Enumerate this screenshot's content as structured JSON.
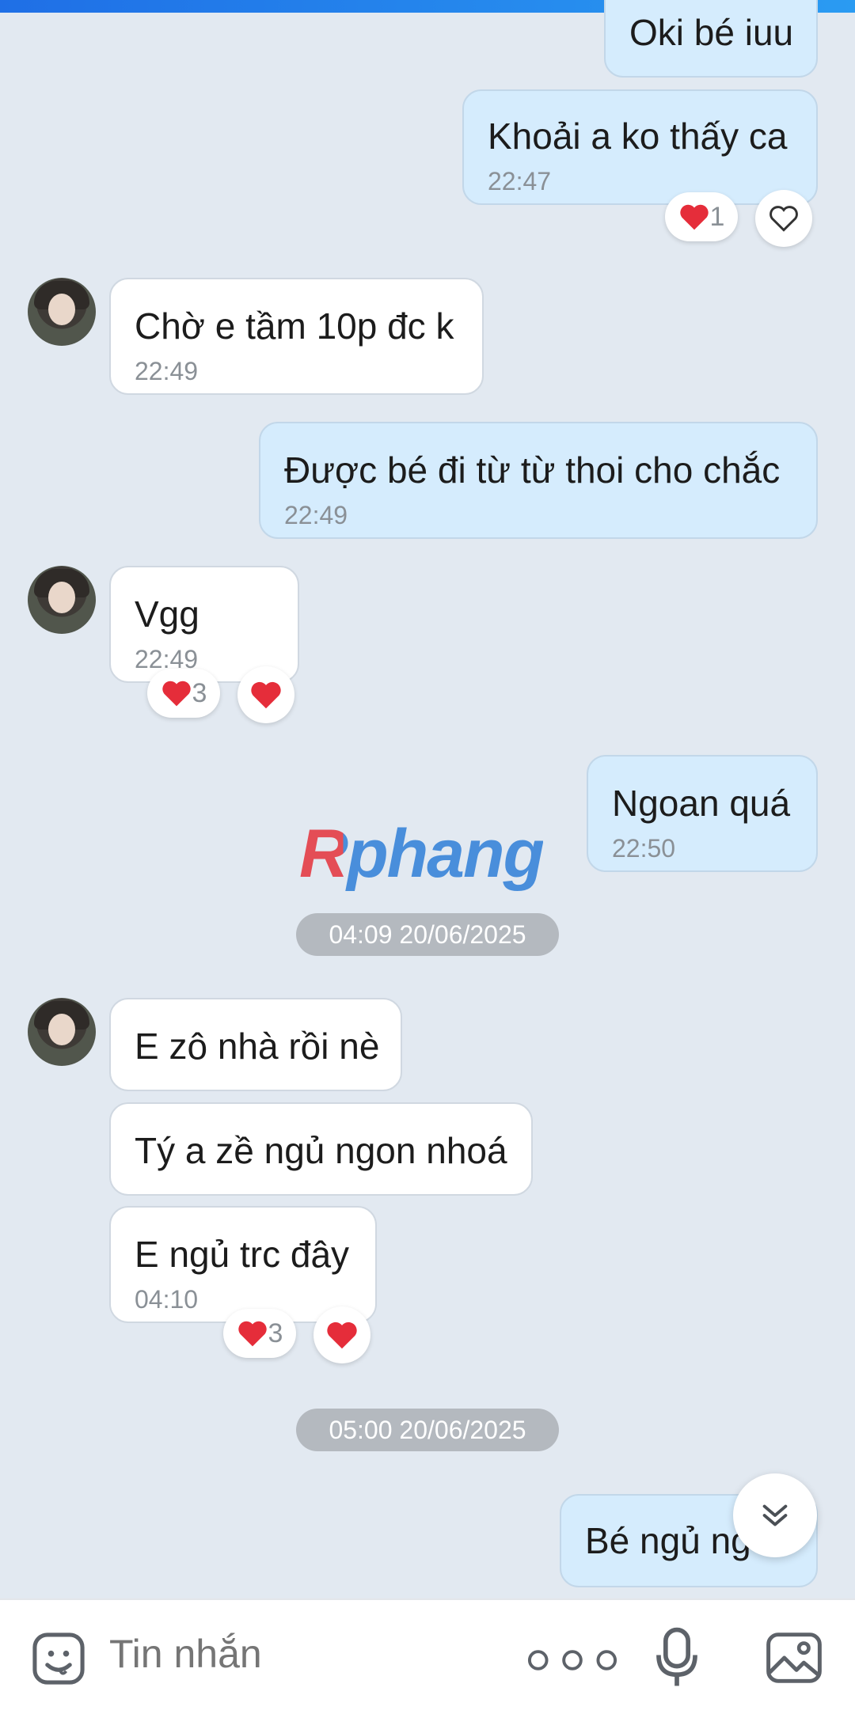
{
  "messages": [
    {
      "text": "Oki bé iuu"
    },
    {
      "text": "Khoải a ko thấy ca",
      "time": "22:47",
      "reaction_count": "1"
    },
    {
      "text": "Chờ e tầm 10p đc k",
      "time": "22:49"
    },
    {
      "text": "Được bé đi từ từ thoi cho chắc",
      "time": "22:49"
    },
    {
      "text": "Vgg",
      "time": "22:49",
      "reaction_count": "3"
    },
    {
      "text": "Ngoan quá",
      "time": "22:50"
    },
    {
      "text": "E zô nhà rồi nè"
    },
    {
      "text": "Tý a zề ngủ ngon nhoá"
    },
    {
      "text": "E ngủ trc đây",
      "time": "04:10",
      "reaction_count": "3"
    },
    {
      "text": "Bé ngủ ng"
    }
  ],
  "timestamps": [
    "04:09 20/06/2025",
    "05:00 20/06/2025"
  ],
  "watermark": "Rphang",
  "composer": {
    "placeholder": "Tin nhắn"
  },
  "icons": {
    "sticker": "sticker-icon",
    "more": "more-dots-icon",
    "mic": "microphone-icon",
    "image": "image-icon",
    "scroll": "scroll-down-icon",
    "heart": "heart-icon",
    "heart_outline": "heart-outline-icon"
  },
  "colors": {
    "incoming": "#ffffff",
    "outgoing": "#d5ecfd",
    "heart": "#e52d3a",
    "background": "#e2e9f1"
  }
}
